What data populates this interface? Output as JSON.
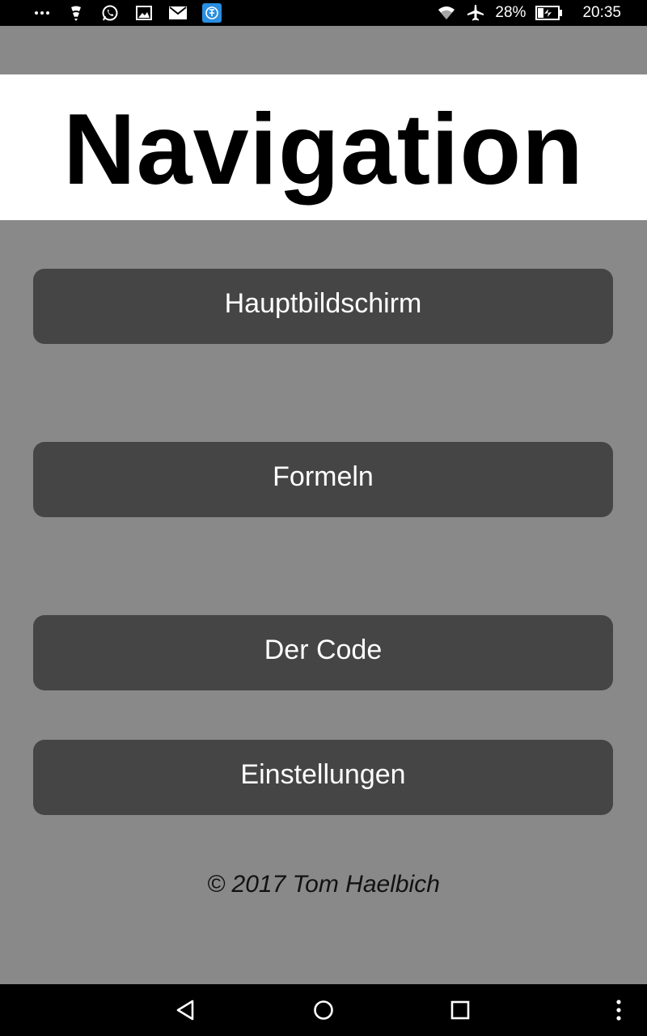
{
  "status_bar": {
    "icons_left": [
      "more-notifications-icon",
      "app-notification-icon",
      "whatsapp-icon",
      "gallery-icon",
      "email-icon",
      "app-badge-icon"
    ],
    "icons_right": [
      "wifi-icon",
      "airplane-mode-icon",
      "battery-charging-icon"
    ],
    "battery_percent": "28%",
    "time": "20:35"
  },
  "header": {
    "title": "Navigation"
  },
  "menu": {
    "items": [
      {
        "label": "Hauptbildschirm"
      },
      {
        "label": "Formeln"
      },
      {
        "label": "Der Code"
      },
      {
        "label": "Einstellungen"
      }
    ]
  },
  "footer": {
    "copyright": "© 2017 Tom Haelbich"
  },
  "system_nav": {
    "buttons": [
      "back-icon",
      "home-icon",
      "recents-icon",
      "overflow-menu-icon"
    ]
  },
  "colors": {
    "background": "#898989",
    "button": "#454545",
    "header": "#ffffff",
    "bars": "#000000"
  }
}
